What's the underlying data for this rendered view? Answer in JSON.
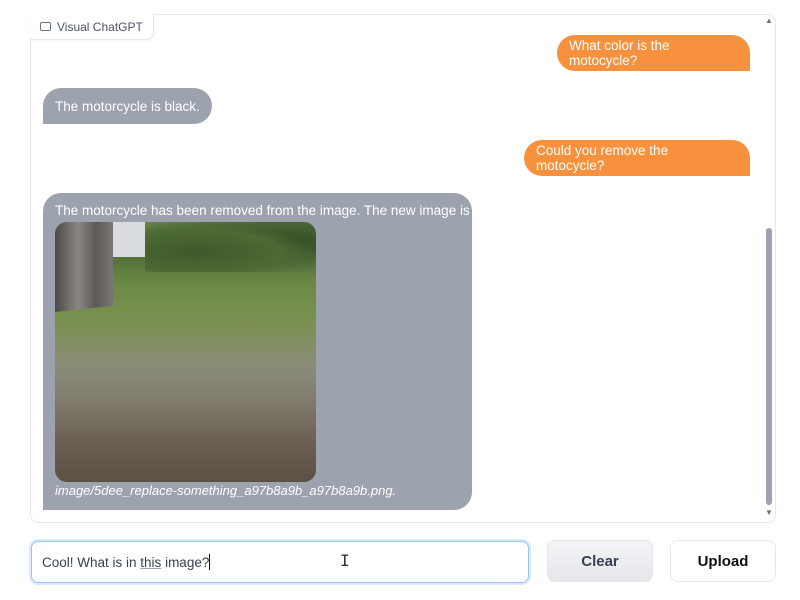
{
  "app": {
    "title": "Visual ChatGPT",
    "icon": "chat-icon"
  },
  "messages": [
    {
      "role": "user",
      "text": "What color is the motocycle?"
    },
    {
      "role": "bot",
      "text": "The motorcycle is black."
    },
    {
      "role": "user",
      "text": "Could you remove the motocycle?"
    },
    {
      "role": "bot",
      "text": "The motorcycle has been removed from the image. The new image is",
      "image_caption": "image/5dee_replace-something_a97b8a9b_a97b8a9b.png."
    }
  ],
  "colors": {
    "user_bubble": "#f7913d",
    "bot_bubble": "#9ca3af"
  },
  "input": {
    "before": "Cool! What is in ",
    "underlined": "this",
    "after": " image?"
  },
  "buttons": {
    "clear": "Clear",
    "upload": "Upload"
  }
}
